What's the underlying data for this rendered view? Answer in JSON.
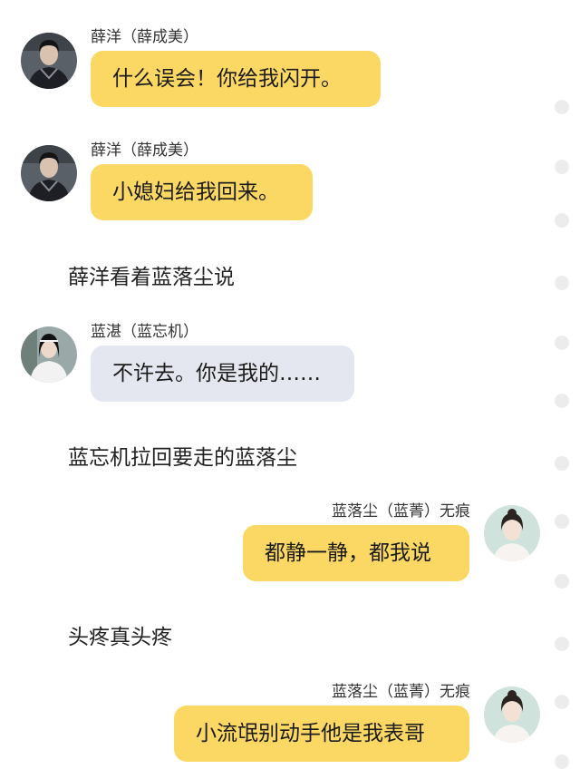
{
  "colors": {
    "bubble_yellow": "#fbd863",
    "bubble_gray": "#e4e7ef",
    "background": "#ffffff",
    "scroll_dot": "#ececec"
  },
  "messages": [
    {
      "type": "chat",
      "side": "left",
      "speaker": "薛洋（薛成美）",
      "text": "什么误会！你给我闪开。",
      "bubble_color": "yellow",
      "avatar": "avatar-xueyang"
    },
    {
      "type": "chat",
      "side": "left",
      "speaker": "薛洋（薛成美）",
      "text": "小媳妇给我回来。",
      "bubble_color": "yellow",
      "avatar": "avatar-xueyang"
    },
    {
      "type": "narration",
      "text": "薛洋看着蓝落尘说"
    },
    {
      "type": "chat",
      "side": "left",
      "speaker": "蓝湛（蓝忘机）",
      "text": "不许去。你是我的……",
      "bubble_color": "gray",
      "avatar": "avatar-lanzhan"
    },
    {
      "type": "narration",
      "text": "蓝忘机拉回要走的蓝落尘"
    },
    {
      "type": "chat",
      "side": "right",
      "speaker": "蓝落尘（蓝菁）无痕",
      "text": "都静一静，都我说",
      "bubble_color": "yellow",
      "avatar": "avatar-lanluochen"
    },
    {
      "type": "narration",
      "text": "头疼真头疼"
    },
    {
      "type": "chat",
      "side": "right",
      "speaker": "蓝落尘（蓝菁）无痕",
      "text": "小流氓别动手他是我表哥",
      "bubble_color": "yellow",
      "avatar": "avatar-lanluochen"
    }
  ]
}
